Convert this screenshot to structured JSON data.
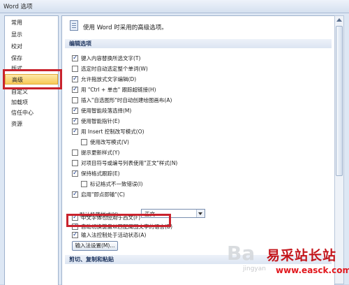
{
  "window": {
    "title": "Word 选项"
  },
  "sidebar": {
    "items": [
      {
        "label": "常用"
      },
      {
        "label": "显示"
      },
      {
        "label": "校对"
      },
      {
        "label": "保存"
      },
      {
        "label": "版式"
      },
      {
        "label": "高级"
      },
      {
        "label": "自定义"
      },
      {
        "label": "加载项"
      },
      {
        "label": "信任中心"
      },
      {
        "label": "资源"
      }
    ],
    "selected": "高级"
  },
  "main": {
    "header": "使用 Word 时采用的高级选项。",
    "section_edit": "编辑选项",
    "options": [
      {
        "label": "键入内容替换所选文字(T)",
        "checked": true
      },
      {
        "label": "选定时自动选定整个单词(W)",
        "checked": false
      },
      {
        "label": "允许拖放式文字编辑(D)",
        "checked": true
      },
      {
        "label": "用 \"Ctrl + 单击\" 跟踪超链接(H)",
        "checked": true
      },
      {
        "label": "插入\"自选图形\"时自动创建绘图画布(A)",
        "checked": false
      },
      {
        "label": "使用智能段落选择(M)",
        "checked": true
      },
      {
        "label": "使用智能指针(E)",
        "checked": true
      },
      {
        "label": "用 Insert 控制改写模式(O)",
        "checked": true
      },
      {
        "label": "使用改写模式(V)",
        "checked": false
      },
      {
        "label": "提示更新样式(Y)",
        "checked": false
      },
      {
        "label": "对项目符号或编号列表使用\"正文\"样式(N)",
        "checked": false
      },
      {
        "label": "保持格式跟踪(E)",
        "checked": true
      },
      {
        "label": "标记格式不一致错误(I)",
        "checked": false
      },
      {
        "label": "启用\"即点即输\"(C)",
        "checked": true
      },
      {
        "label": "中文字体也应用于西文(F)",
        "checked": true
      },
      {
        "label": "自动切换键盘以匹配周围文字的语言(B)",
        "checked": true
      },
      {
        "label": "输入法控制处于活动状态(A)",
        "checked": true
      }
    ],
    "default_para_label": "默认段落样式(Y):",
    "default_para_value": "正文",
    "ime_button": "输入法设置(M)...",
    "section_clip": "剪切、复制和粘贴"
  },
  "watermark": {
    "site_cn": "易采站长站",
    "site_url": "www.easck.com",
    "site_url_color": "#e1161c",
    "site_cn_color": "#c4151b",
    "baidu_partial": "Ba",
    "baidu_sub": "jingyan"
  }
}
